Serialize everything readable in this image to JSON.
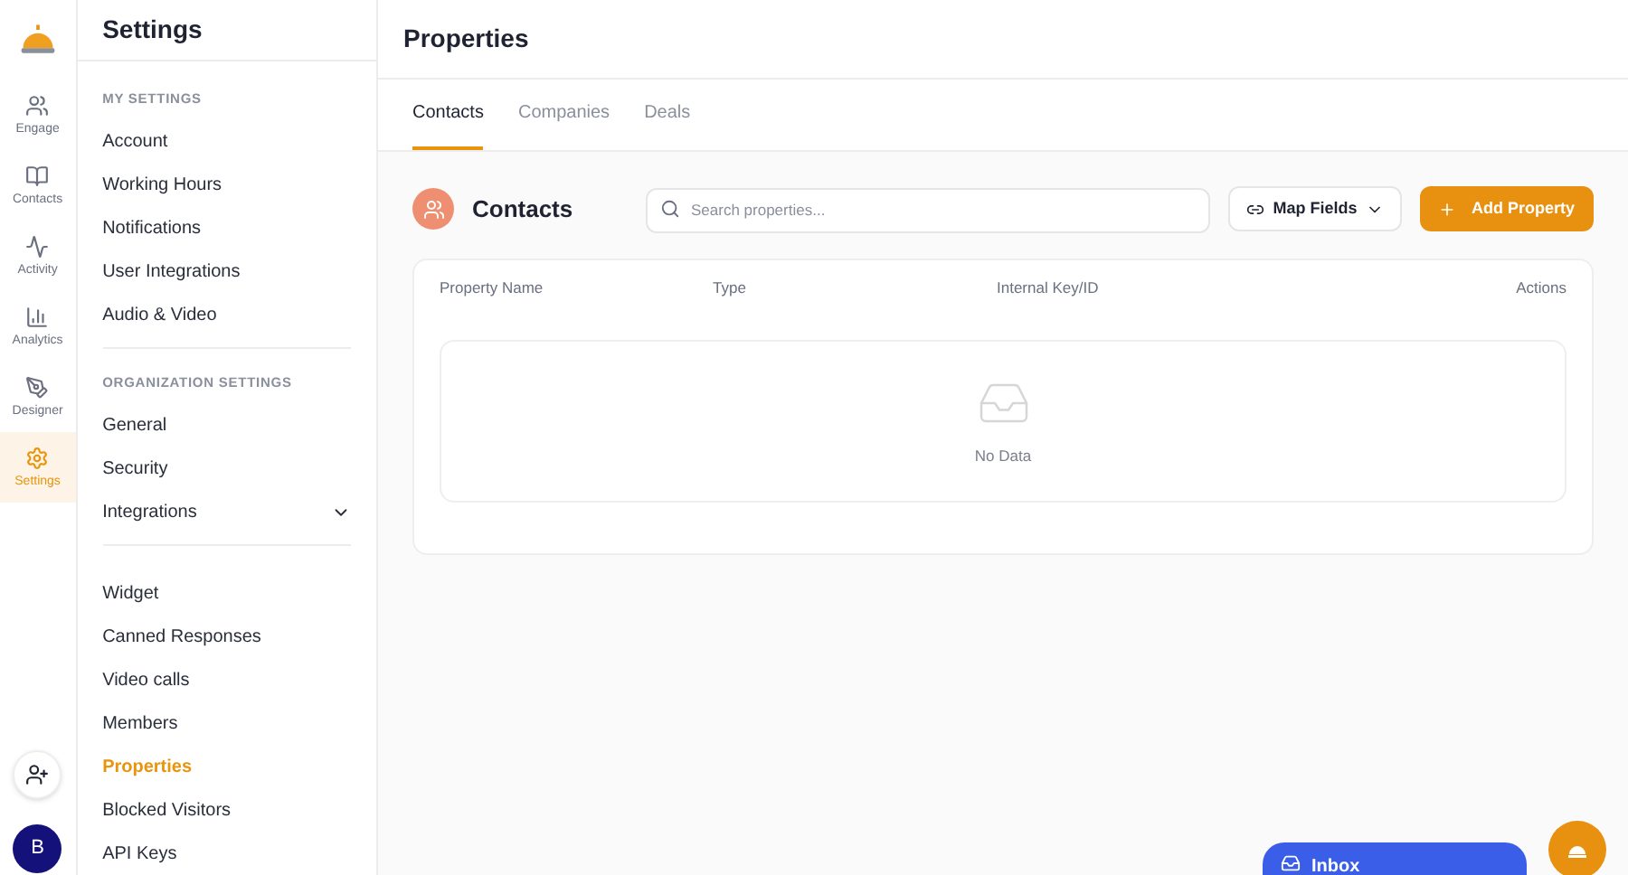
{
  "nav_rail": [
    {
      "label": "Engage",
      "selected": false
    },
    {
      "label": "Contacts",
      "selected": false
    },
    {
      "label": "Activity",
      "selected": false
    },
    {
      "label": "Analytics",
      "selected": false
    },
    {
      "label": "Designer",
      "selected": false
    },
    {
      "label": "Settings",
      "selected": true
    }
  ],
  "avatar": {
    "initial": "B"
  },
  "settings_panel": {
    "title": "Settings",
    "sections": [
      {
        "heading": "MY SETTINGS",
        "items": [
          {
            "label": "Account",
            "selected": false
          },
          {
            "label": "Working Hours",
            "selected": false
          },
          {
            "label": "Notifications",
            "selected": false
          },
          {
            "label": "User Integrations",
            "selected": false
          },
          {
            "label": "Audio & Video",
            "selected": false
          }
        ]
      },
      {
        "heading": "ORGANIZATION SETTINGS",
        "items": [
          {
            "label": "General",
            "selected": false
          },
          {
            "label": "Security",
            "selected": false
          },
          {
            "label": "Integrations",
            "selected": false,
            "expanded": false
          }
        ]
      },
      {
        "items": [
          {
            "label": "Widget",
            "selected": false
          },
          {
            "label": "Canned Responses",
            "selected": false
          },
          {
            "label": "Video calls",
            "selected": false
          },
          {
            "label": "Members",
            "selected": false
          },
          {
            "label": "Properties",
            "selected": true
          },
          {
            "label": "Blocked Visitors",
            "selected": false
          },
          {
            "label": "API Keys",
            "selected": false
          }
        ]
      }
    ]
  },
  "page": {
    "title": "Properties",
    "tabs": [
      {
        "label": "Contacts",
        "selected": true
      },
      {
        "label": "Companies",
        "selected": false
      },
      {
        "label": "Deals",
        "selected": false
      }
    ],
    "section_title": "Contacts",
    "search": {
      "placeholder": "Search properties..."
    },
    "map_fields_button": "Map Fields",
    "add_button": "Add Property",
    "table": {
      "columns": [
        "Property Name",
        "Type",
        "Internal Key/ID",
        "Actions"
      ],
      "empty_text": "No Data"
    }
  },
  "inbox_widget": {
    "label": "Inbox"
  }
}
